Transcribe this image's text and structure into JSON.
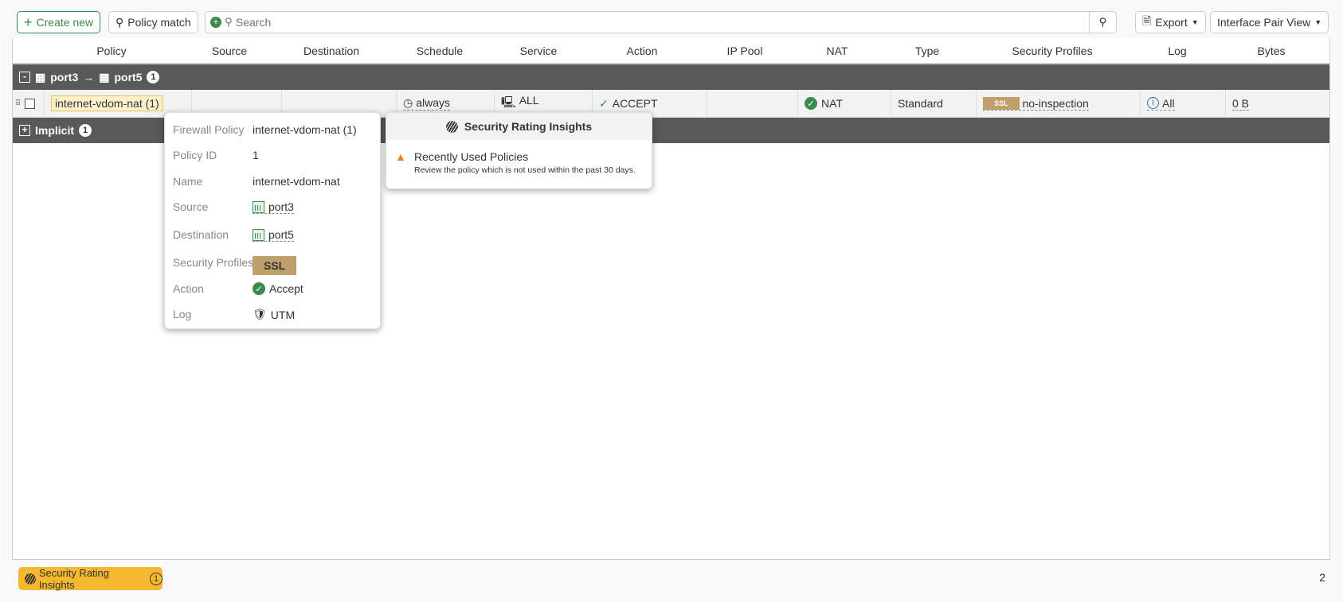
{
  "toolbar": {
    "create_new": "Create new",
    "policy_match": "Policy match",
    "search_placeholder": "Search",
    "export": "Export",
    "view": "Interface Pair View"
  },
  "columns": [
    "Policy",
    "Source",
    "Destination",
    "Schedule",
    "Service",
    "Action",
    "IP Pool",
    "NAT",
    "Type",
    "Security Profiles",
    "Log",
    "Bytes"
  ],
  "group": {
    "from": "port3",
    "arrow": "→",
    "to": "port5",
    "count": "1",
    "toggle": "-"
  },
  "row": {
    "policy": "internet-vdom-nat (1)",
    "source": "",
    "destination": "",
    "schedule": "always",
    "service": "ALL",
    "action": "ACCEPT",
    "ip_pool": "",
    "nat": "NAT",
    "type": "Standard",
    "ssl_badge": "SSL",
    "security_profile": "no-inspection",
    "log": "All",
    "bytes": "0 B"
  },
  "implicit": {
    "label": "Implicit",
    "count": "1",
    "toggle": "+"
  },
  "policy_popup": {
    "rows": [
      {
        "label": "Firewall Policy",
        "value": "internet-vdom-nat (1)"
      },
      {
        "label": "Policy ID",
        "value": "1"
      },
      {
        "label": "Name",
        "value": "internet-vdom-nat"
      },
      {
        "label": "Source",
        "value": "port3"
      },
      {
        "label": "Destination",
        "value": "port5"
      },
      {
        "label": "Security Profiles",
        "value": "SSL"
      },
      {
        "label": "Action",
        "value": "Accept"
      },
      {
        "label": "Log",
        "value": "UTM"
      }
    ]
  },
  "insights_popup": {
    "title": "Security Rating Insights",
    "item_title": "Recently Used Policies",
    "item_desc": "Review the policy which is not used within the past 30 days."
  },
  "footer": {
    "insights_label": "Security Rating Insights",
    "insights_count": "1",
    "total": "2"
  },
  "colors": {
    "accent": "#3b8a4e",
    "group_bg": "#595959",
    "ssl": "#bf9f6c",
    "insights": "#f5b82e",
    "warning": "#e8821e"
  }
}
